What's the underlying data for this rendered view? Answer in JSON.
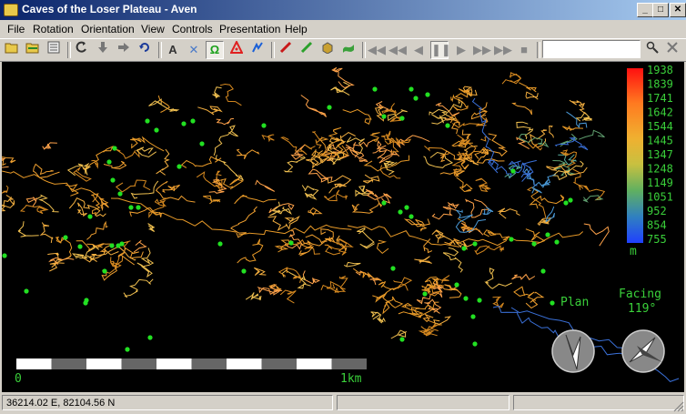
{
  "window": {
    "title": "Caves of the Loser Plateau - Aven",
    "minimize": "_",
    "maximize": "□",
    "close": "✕"
  },
  "menu": [
    "File",
    "Rotation",
    "Orientation",
    "View",
    "Controls",
    "Presentation",
    "Help"
  ],
  "toolbar": {
    "groups": [
      [
        "open-icon",
        "open-pres-icon",
        "print-icon"
      ],
      [
        "rotate-icon",
        "step-down-icon",
        "step-right-icon",
        "undo-icon"
      ],
      [
        "label-icon",
        "cross-icon",
        "entrance-icon",
        "fix-icon",
        "exported-icon"
      ],
      [
        "red-leg-icon",
        "green-leg-icon",
        "solid-icon",
        "surface-icon"
      ],
      [
        "rewind-icon",
        "back-icon",
        "step-back-icon",
        "pause-icon",
        "play-icon",
        "fast-forward-icon",
        "end-icon",
        "stop-icon"
      ]
    ],
    "search_value": "",
    "find_icon": "search-icon",
    "hide_icon": "clear-icon"
  },
  "colour_key": {
    "values": [
      "1938",
      "1839",
      "1741",
      "1642",
      "1544",
      "1445",
      "1347",
      "1248",
      "1149",
      "1051",
      "952",
      "854",
      "755"
    ],
    "unit": "m",
    "colors": [
      "#ff2020",
      "#ff6a20",
      "#ffa030",
      "#e8c030",
      "#a8c040",
      "#60a050",
      "#2060ff"
    ]
  },
  "scale_bar": {
    "start_label": "0",
    "end_label": "1km"
  },
  "view": {
    "mode": "Plan",
    "facing_label": "Facing",
    "facing_value": "119°"
  },
  "status": {
    "coordinates": "36214.02 E, 82104.56 N",
    "second": "",
    "third": ""
  }
}
